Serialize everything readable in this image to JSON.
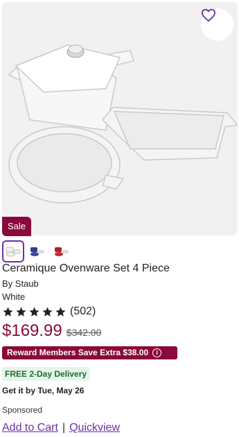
{
  "product": {
    "sale_label": "Sale",
    "title": "Ceramique Ovenware Set 4 Piece",
    "brand": "By Staub",
    "color": "White",
    "rating": {
      "stars": 5,
      "count": "(502)"
    },
    "price": {
      "current": "$169.99",
      "original": "$342.00"
    },
    "reward_text": "Reward Members Save Extra $38.00",
    "delivery_badge": "FREE 2-Day Delivery",
    "get_by": "Get it by Tue, May 26",
    "sponsored": "Sponsored",
    "swatches": [
      {
        "icon": "white-swatch",
        "selected": true
      },
      {
        "icon": "blue-swatch",
        "selected": false
      },
      {
        "icon": "red-swatch",
        "selected": false
      }
    ]
  },
  "actions": {
    "add_to_cart": "Add to Cart",
    "separator": "|",
    "quickview": "Quickview"
  },
  "colors": {
    "brand": "#8a0a3b",
    "link": "#6b2fa8",
    "delivery_bg": "#e6f4ea",
    "delivery_text": "#1e6b2f"
  }
}
